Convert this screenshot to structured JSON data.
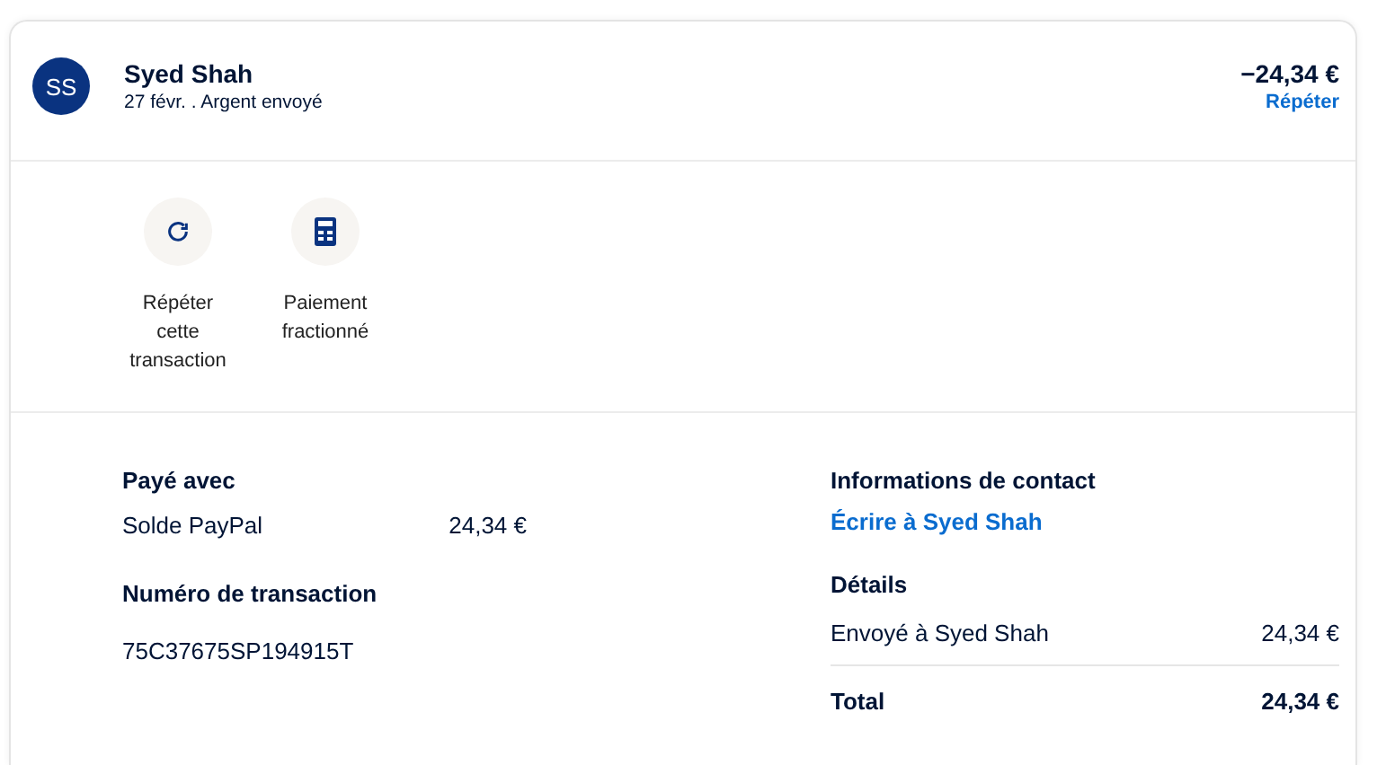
{
  "header": {
    "avatar": "SS",
    "name": "Syed Shah",
    "subtitle": "27 févr. . Argent envoyé",
    "amount": "−24,34 €",
    "repeat_link": "Répéter"
  },
  "actions": [
    {
      "kind": "repeat",
      "label": "Répéter cette transaction"
    },
    {
      "kind": "split",
      "label": "Paiement fractionné"
    }
  ],
  "paid_with": {
    "title": "Payé avec",
    "method": "Solde PayPal",
    "amount": "24,34 €"
  },
  "transaction": {
    "title": "Numéro de transaction",
    "id": "75C37675SP194915T"
  },
  "contact": {
    "title": "Informations de contact",
    "link": "Écrire à Syed Shah"
  },
  "details": {
    "title": "Détails",
    "rows": [
      {
        "label": "Envoyé à Syed Shah",
        "value": "24,34 €",
        "kind": "item"
      },
      {
        "label": "Total",
        "value": "24,34 €",
        "kind": "total"
      }
    ]
  }
}
